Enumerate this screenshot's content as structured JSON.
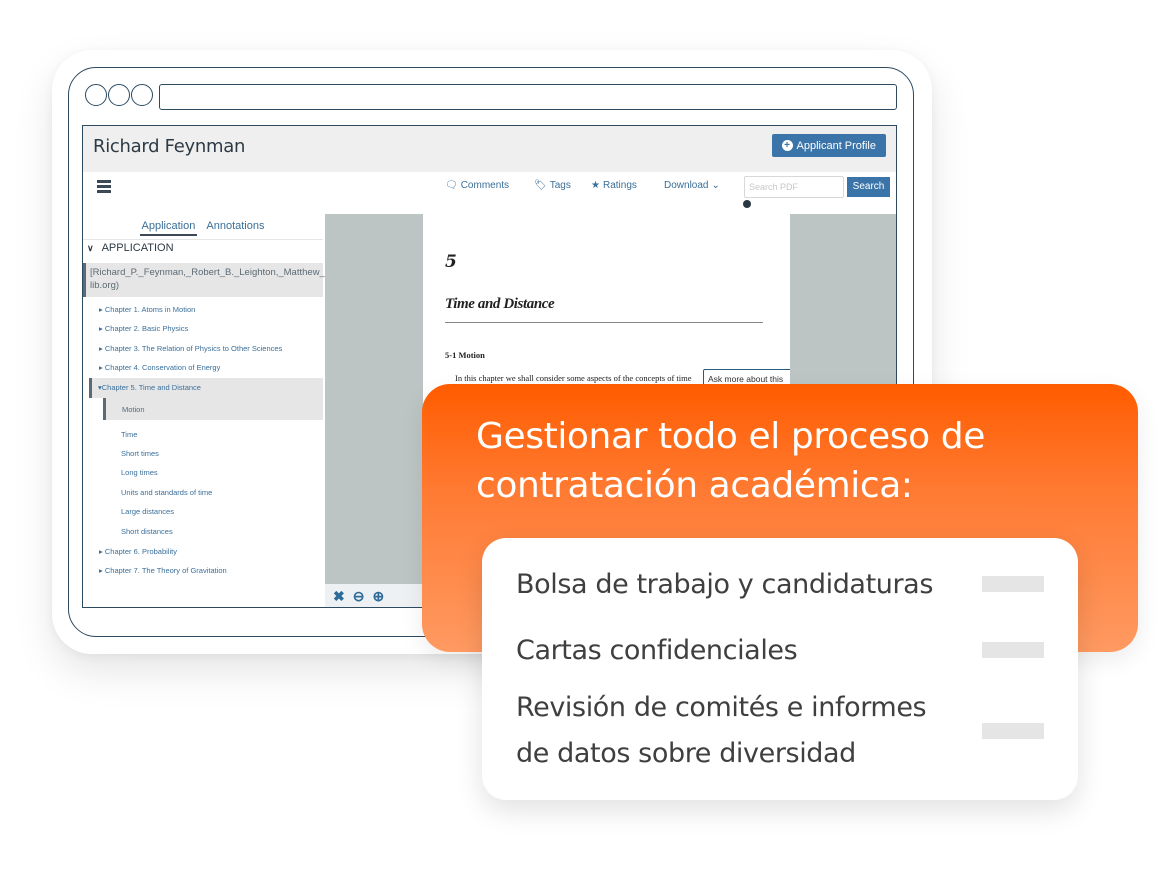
{
  "window": {
    "app_title": "Richard Feynman",
    "applicant_profile_label": "Applicant Profile"
  },
  "toolbar": {
    "comments_label": "Comments",
    "tags_label": "Tags",
    "ratings_label": "Ratings",
    "download_label": "Download",
    "search_placeholder": "Search PDF",
    "search_button_label": "Search"
  },
  "sidebar": {
    "tabs": [
      {
        "label": "Application",
        "active": true
      },
      {
        "label": "Annotations",
        "active": false
      }
    ],
    "section_label": "APPLICATION",
    "document_name": "[Richard_P._Feynman,_Robert_B._Leighton,_Matthew_S(z-lib.org)",
    "chapters": [
      {
        "label": "Chapter 1. Atoms in Motion",
        "expanded": false
      },
      {
        "label": "Chapter 2. Basic Physics",
        "expanded": false
      },
      {
        "label": "Chapter 3. The Relation of Physics to Other Sciences",
        "expanded": false
      },
      {
        "label": "Chapter 4. Conservation of Energy",
        "expanded": false
      },
      {
        "label": "Chapter 5. Time and Distance",
        "expanded": true
      },
      {
        "label": "Chapter 6. Probability",
        "expanded": false
      },
      {
        "label": "Chapter 7. The Theory of Gravitation",
        "expanded": false
      }
    ],
    "subsections": [
      "Motion",
      "Time",
      "Short times",
      "Long times",
      "Units and standards of time",
      "Large distances",
      "Short distances"
    ],
    "active_subsection": "Motion"
  },
  "pdf": {
    "chapter_number": "5",
    "chapter_title": "Time and Distance",
    "section_heading": "5-1 Motion",
    "body_text": "In this chapter we shall consider some aspects of the concepts of time",
    "ask_more_label": "Ask more about this"
  },
  "viewer_controls": {
    "icons": [
      "fullscreen-icon",
      "zoom-out-icon",
      "zoom-in-icon"
    ]
  },
  "promo": {
    "title": "Gestionar todo el proceso de contratación académica:",
    "items": [
      "Bolsa de trabajo y candidaturas",
      "Cartas confidenciales",
      "Revisión de comités e informes de datos sobre diversidad"
    ],
    "accent_color": "#ff5c00"
  }
}
